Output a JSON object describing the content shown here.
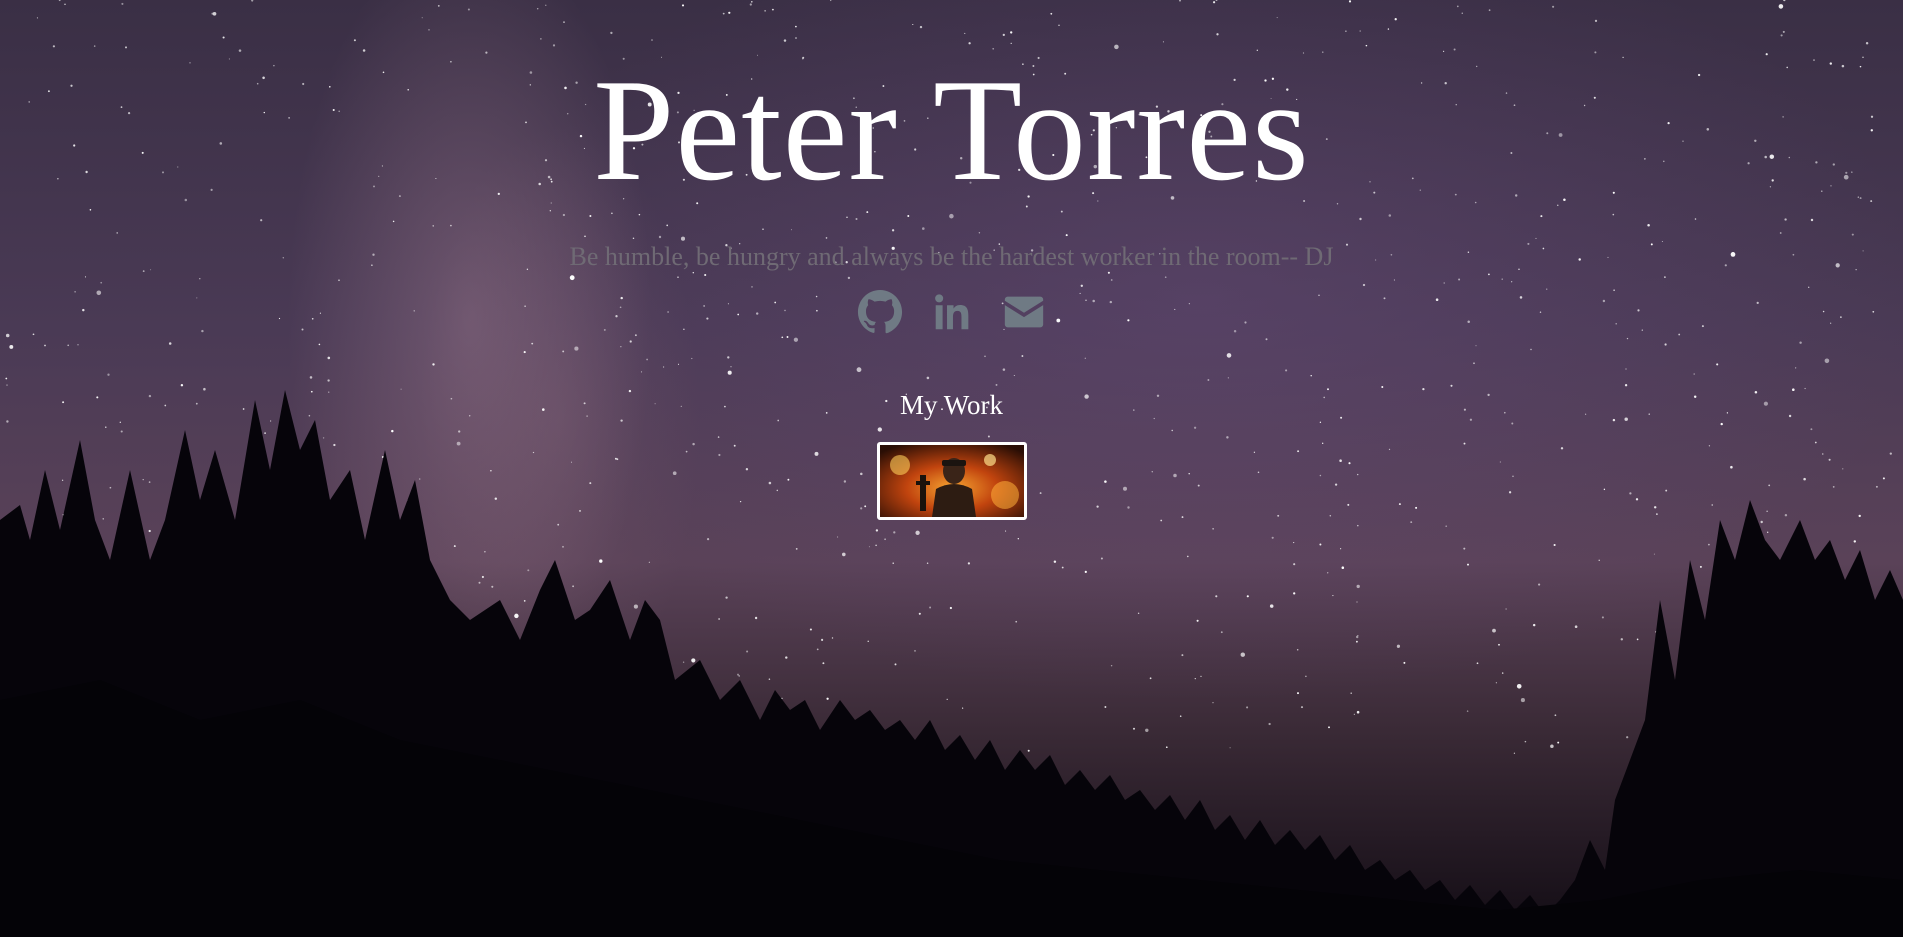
{
  "header": {
    "name": "Peter Torres",
    "quote": "Be humble, be hungry and always be the hardest worker in the room-- DJ"
  },
  "socials": [
    {
      "icon": "github-icon"
    },
    {
      "icon": "linkedin-icon"
    },
    {
      "icon": "envelope-icon"
    }
  ],
  "work": {
    "title": "My Work",
    "thumbnail_icon": "project-thumbnail"
  },
  "colors": {
    "heading": "#ffffff",
    "quote": "#6f6a74",
    "icons": "#6f7a84"
  }
}
